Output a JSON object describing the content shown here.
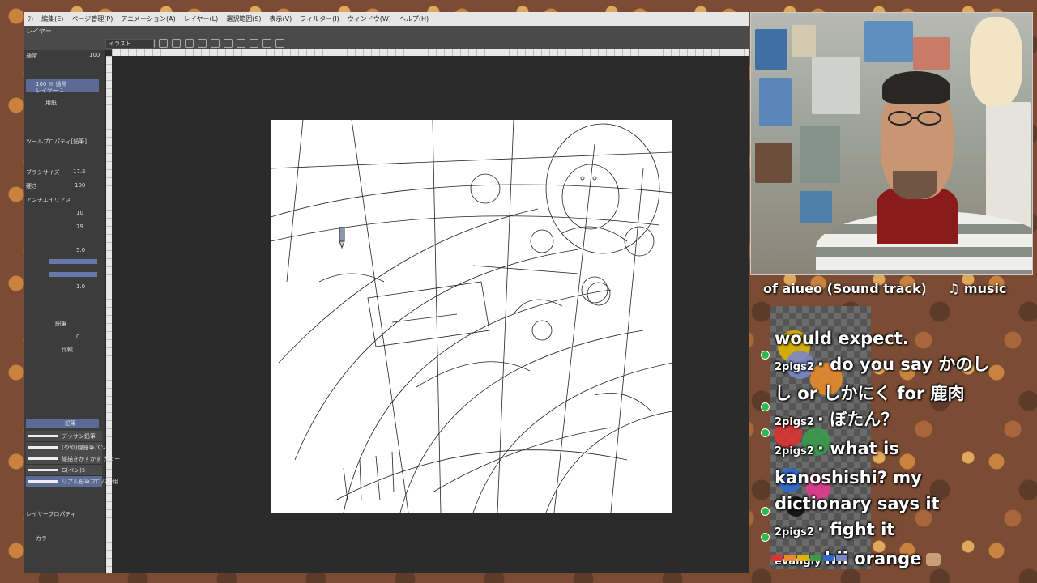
{
  "menu": [
    "ﾌ)",
    "編集(E)",
    "ページ管理(P)",
    "アニメーション(A)",
    "レイヤー(L)",
    "選択範囲(S)",
    "表示(V)",
    "フィルター(I)",
    "ウィンドウ(W)",
    "ヘルプ(H)"
  ],
  "left_panel": {
    "layer_tab": "レイヤー",
    "blend_mode": "通常",
    "opacity": "100",
    "layer_selected": "100 % 通常",
    "layer_selected_name": "レイヤー 1",
    "paper_layer": "用紙",
    "tool_property_title": "ツールプロパティ[鉛筆]",
    "brush_size_label": "ブラシサイズ",
    "brush_size_value": "17.5",
    "density_label": "硬さ",
    "density_value": "100",
    "antialias_label": "アンチエイリアス",
    "value_10": "10",
    "value_79": "79",
    "value_50": "5.0",
    "value_1": "1.0",
    "value_0": "0",
    "button_label": "細筆",
    "stroke_label": "比較",
    "subtool_tab": "鉛筆",
    "brushes": [
      "デッサン鉛筆",
      "(やや)線鉛筆パン",
      "線描きかすかす カラー",
      "G(ペン)5",
      "リアル鉛筆プロパン用"
    ],
    "layer_property": "レイヤープロパティ",
    "color_label": "カラー"
  },
  "document_tab": "イラスト",
  "stream_overlay": {
    "title": "of aiueo (Sound track)",
    "music": "♫ music"
  },
  "chat": [
    {
      "user": "",
      "text": "would expect."
    },
    {
      "user": "2pigs2",
      "text": "do you say かのし"
    },
    {
      "user": "",
      "text": "し or しかにく for 鹿肉"
    },
    {
      "user": "2pigs2",
      "text": "ぼたん？"
    },
    {
      "user": "2pigs2",
      "text": "what is"
    },
    {
      "user": "",
      "text": "kanoshishi? my"
    },
    {
      "user": "",
      "text": "dictionary says it"
    },
    {
      "user": "2pigs2",
      "text": "fight it"
    },
    {
      "user": "evangly",
      "text": "hii orange"
    }
  ],
  "colors": {
    "accent": "#5b6b95",
    "badge": "#2db84d",
    "canvas": "#ffffff"
  }
}
